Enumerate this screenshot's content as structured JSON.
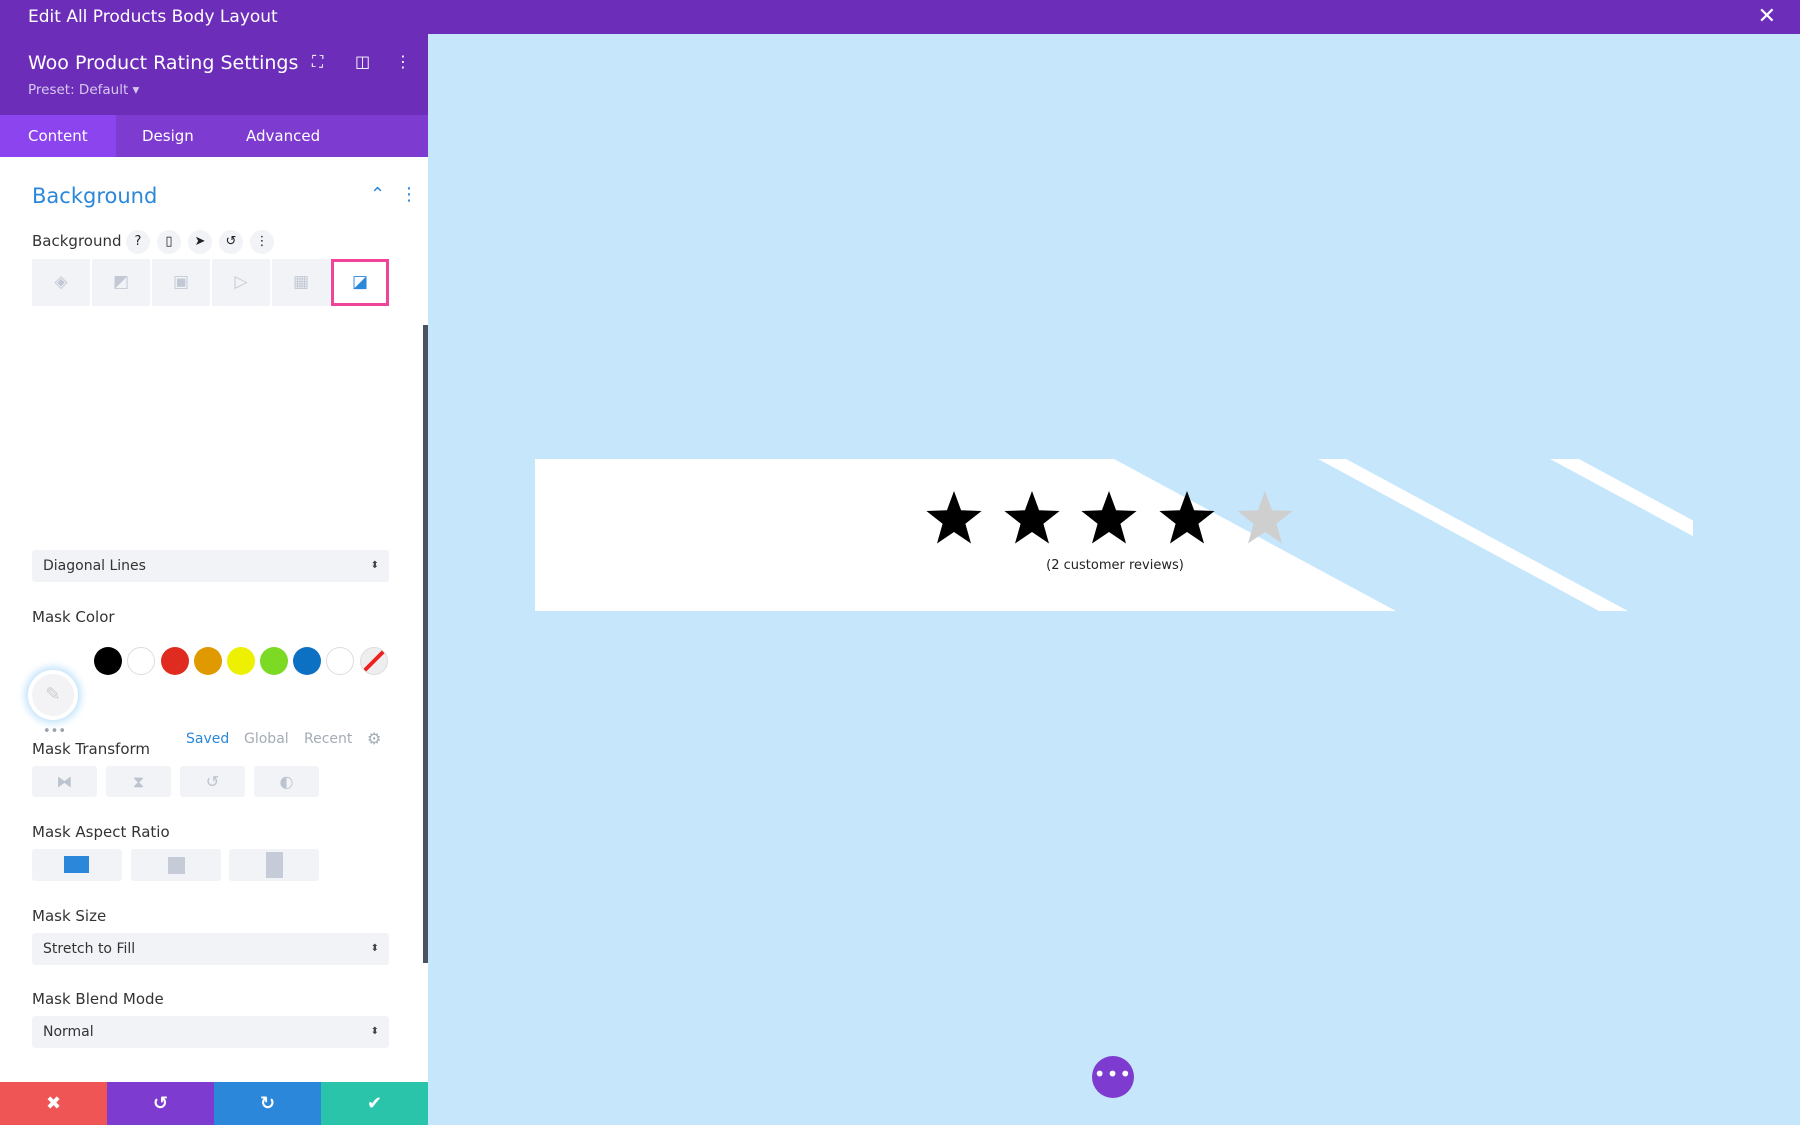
{
  "window": {
    "title": "Edit All Products Body Layout",
    "close_icon": "close-icon"
  },
  "panel": {
    "title": "Woo Product Rating Settings",
    "preset": "Preset: Default ▾",
    "tabs": [
      {
        "label": "Content",
        "active": true
      },
      {
        "label": "Design"
      },
      {
        "label": "Advanced"
      }
    ],
    "section_title": "Background",
    "background_label": "Background",
    "background_types": [
      "color",
      "gradient",
      "image",
      "video",
      "pattern",
      "mask"
    ],
    "selected_background_type": "mask",
    "mask_style": "Diagonal Lines",
    "mask_color_label": "Mask Color",
    "swatches": [
      "#000000",
      "#ffffff",
      "#e02b20",
      "#e09900",
      "#edf000",
      "#7cda24",
      "#0c71c3",
      "#ffffff",
      "none"
    ],
    "palette_tabs": [
      "Saved",
      "Global",
      "Recent"
    ],
    "active_palette": "Saved",
    "mask_transform_label": "Mask Transform",
    "mask_aspect_ratio_label": "Mask Aspect Ratio",
    "selected_aspect_ratio": "landscape",
    "mask_size_label": "Mask Size",
    "mask_size": "Stretch to Fill",
    "mask_blend_label": "Mask Blend Mode",
    "mask_blend": "Normal",
    "footer": {
      "discard_color": "#ef5555",
      "undo_color": "#7e3bd0",
      "redo_color": "#2b87da",
      "save_color": "#29c4a9"
    }
  },
  "preview": {
    "background": "#c5e6fb",
    "rating": 4,
    "max_rating": 5,
    "reviews_text": "(2 customer reviews)"
  },
  "accent": "#6c2eb9"
}
